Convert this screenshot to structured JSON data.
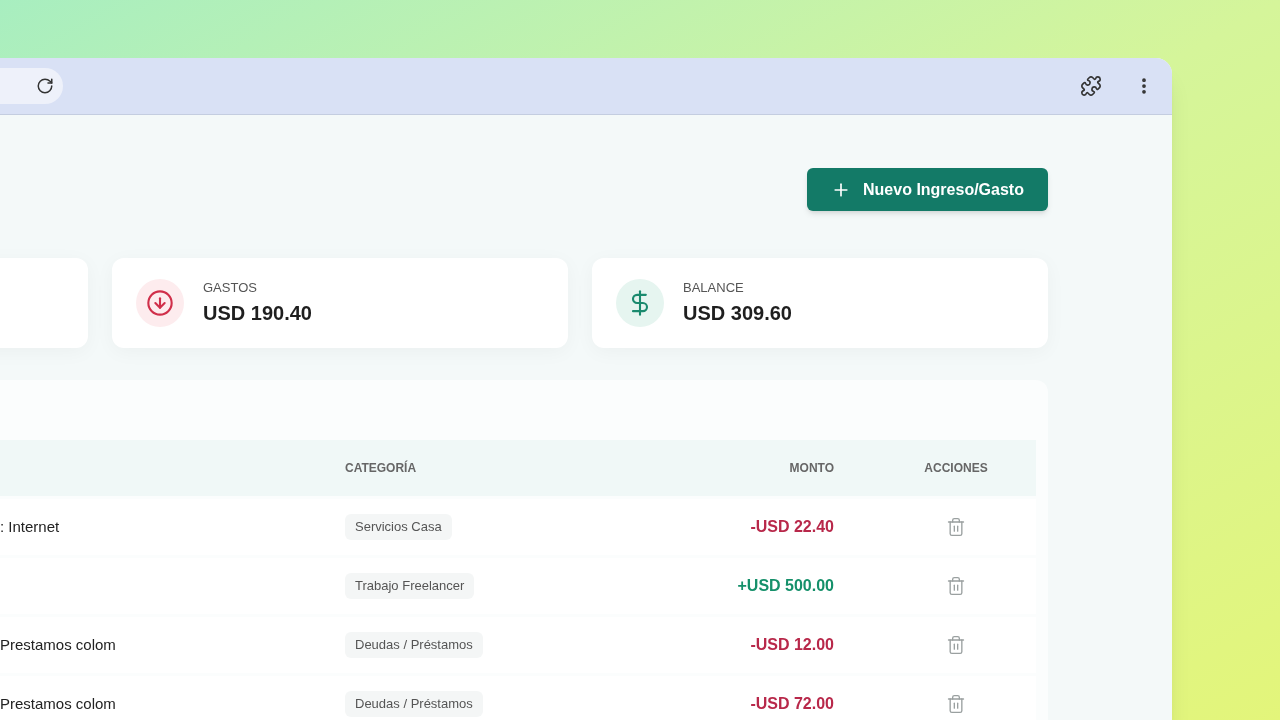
{
  "new_button": {
    "label": "Nuevo Ingreso/Gasto"
  },
  "summary_cards": [
    {
      "kind": "blank"
    },
    {
      "kind": "expense",
      "label": "GASTOS",
      "value": "USD 190.40"
    },
    {
      "kind": "balance",
      "label": "BALANCE",
      "value": "USD 309.60"
    }
  ],
  "table": {
    "columns": [
      "CATEGORÍA",
      "MONTO",
      "ACCIONES"
    ],
    "rows": [
      {
        "description": ": Internet",
        "category": "Servicios Casa",
        "amount": "-USD 22.40",
        "kind": "expense"
      },
      {
        "category": "Trabajo Freelancer",
        "amount": "+USD 500.00",
        "kind": "income"
      },
      {
        "description": "Prestamos colom",
        "category": "Deudas / Préstamos",
        "amount": "-USD 12.00",
        "kind": "expense"
      },
      {
        "description": "Prestamos colom",
        "category": "Deudas / Préstamos",
        "amount": "-USD 72.00",
        "kind": "expense"
      }
    ]
  }
}
